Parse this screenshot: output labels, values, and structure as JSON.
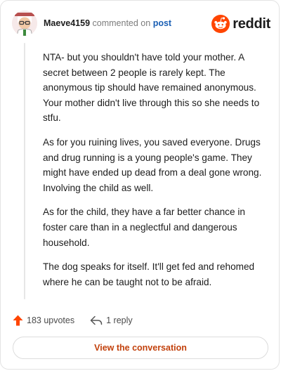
{
  "header": {
    "username": "Maeve4159",
    "commented_on": "commented on",
    "post_link": "post",
    "brand": "reddit"
  },
  "comment": {
    "paragraphs": [
      "NTA- but you shouldn't have told your mother. A secret between 2 people is rarely kept. The anonymous tip should have remained anonymous. Your mother didn't live through this so she needs to stfu.",
      "As for you ruining lives, you saved everyone. Drugs and drug running is a young people's game. They might have ended up dead from a deal gone wrong. Involving the child as well.",
      "As for the child, they have a far better chance in foster care than in a neglectful and dangerous household.",
      "The dog speaks for itself. It'll get fed and rehomed where he can be taught not to be afraid."
    ]
  },
  "actions": {
    "upvotes": "183 upvotes",
    "replies": "1 reply"
  },
  "footer": {
    "view_conversation": "View the conversation"
  },
  "colors": {
    "upvote_arrow": "#ff4500",
    "reddit_orange": "#ff4500",
    "link_blue": "#1a5fb4",
    "button_text": "#c2410c"
  },
  "icons": {
    "avatar": "snoo-avatar",
    "logo": "reddit-logo-icon",
    "upvote": "upvote-arrow-icon",
    "reply": "reply-arrow-icon"
  }
}
